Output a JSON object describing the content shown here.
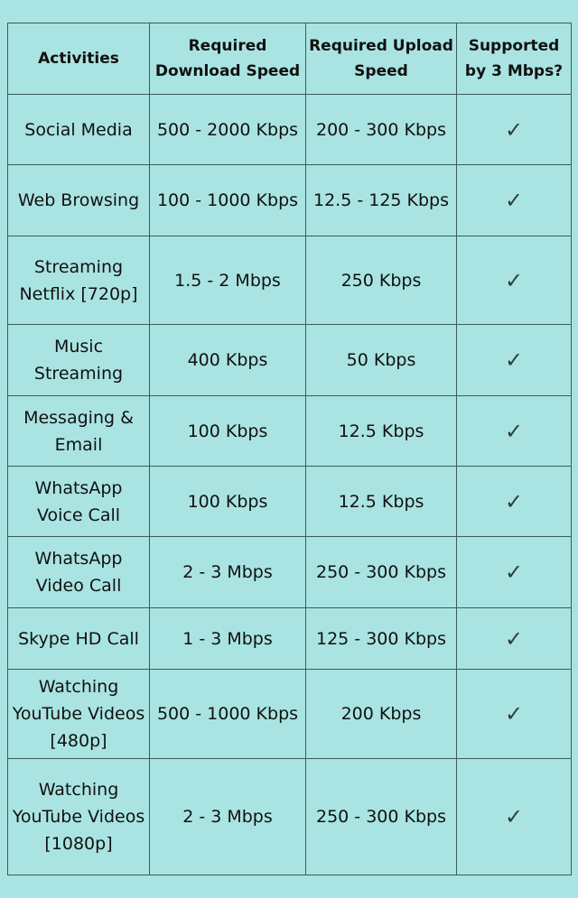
{
  "headers": [
    "Activities",
    "Required Download Speed",
    "Required Upload Speed",
    "Supported by 3 Mbps?"
  ],
  "rows": [
    {
      "activity": "Social Media",
      "download": "500 - 2000 Kbps",
      "upload": "200 - 300 Kbps",
      "supported": "✓"
    },
    {
      "activity": "Web Browsing",
      "download": "100 - 1000 Kbps",
      "upload": "12.5 - 125 Kbps",
      "supported": "✓"
    },
    {
      "activity": "Streaming Netflix [720p]",
      "download": "1.5 - 2 Mbps",
      "upload": "250 Kbps",
      "supported": "✓"
    },
    {
      "activity": "Music Streaming",
      "download": "400 Kbps",
      "upload": "50 Kbps",
      "supported": "✓"
    },
    {
      "activity": "Messaging & Email",
      "download": "100 Kbps",
      "upload": "12.5 Kbps",
      "supported": "✓"
    },
    {
      "activity": "WhatsApp Voice Call",
      "download": "100 Kbps",
      "upload": "12.5 Kbps",
      "supported": "✓"
    },
    {
      "activity": "WhatsApp Video Call",
      "download": "2 - 3 Mbps",
      "upload": "250 - 300 Kbps",
      "supported": "✓"
    },
    {
      "activity": "Skype HD Call",
      "download": "1 - 3 Mbps",
      "upload": "125 - 300 Kbps",
      "supported": "✓"
    },
    {
      "activity": "Watching YouTube Videos [480p]",
      "download": "500 - 1000 Kbps",
      "upload": "200 Kbps",
      "supported": "✓"
    },
    {
      "activity": "Watching YouTube Videos [1080p]",
      "download": "2 - 3 Mbps",
      "upload": "250 - 300 Kbps",
      "supported": "✓"
    }
  ],
  "colors": {
    "background": "#a9e4e2",
    "border": "#3b5c5c",
    "check": "#2e3e44"
  }
}
